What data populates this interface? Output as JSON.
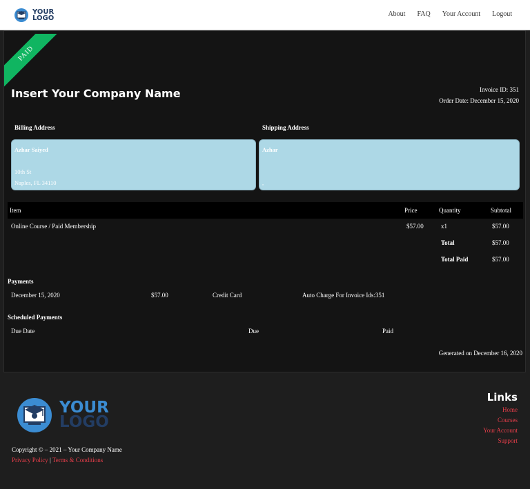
{
  "header": {
    "logo_line1": "YOUR",
    "logo_line2": "LOGO",
    "nav": [
      "About",
      "FAQ",
      "Your Account",
      "Logout"
    ]
  },
  "invoice": {
    "ribbon": "PAID",
    "company_name": "Insert Your Company Name",
    "invoice_id": "Invoice ID: 351",
    "order_date": "Order Date: December 15, 2020",
    "billing": {
      "label": "Billing Address",
      "name": "Azhar Saiyed",
      "street": "10th St",
      "city": "Naples, FL 34110"
    },
    "shipping": {
      "label": "Shipping Address",
      "name": "Azhar",
      "line": ","
    },
    "items_header": {
      "item": "Item",
      "price": "Price",
      "quantity": "Quantity",
      "subtotal": "Subtotal"
    },
    "items": [
      {
        "item": "Online Course / Paid Membership",
        "price": "$57.00",
        "quantity": "x1",
        "subtotal": "$57.00"
      }
    ],
    "total_label": "Total",
    "total_value": "$57.00",
    "total_paid_label": "Total Paid",
    "total_paid_value": "$57.00",
    "payments_title": "Payments",
    "payments": [
      {
        "date": "December 15, 2020",
        "amount": "$57.00",
        "method": "Credit Card",
        "note": "Auto Charge For Invoice Ids:351"
      }
    ],
    "scheduled_title": "Scheduled Payments",
    "scheduled_header": {
      "due_date": "Due Date",
      "due": "Due",
      "paid": "Paid"
    },
    "generated": "Generated on December 16, 2020"
  },
  "footer": {
    "logo_line1": "YOUR",
    "logo_line2": "LOGO",
    "copyright": "Copyright © – 2021 – Your Company Name",
    "privacy": "Privacy Policy",
    "separator": "|",
    "terms": "Terms & Conditions",
    "links_title": "Links",
    "links": [
      "Home",
      "Courses",
      "Your Account",
      "Support"
    ]
  }
}
